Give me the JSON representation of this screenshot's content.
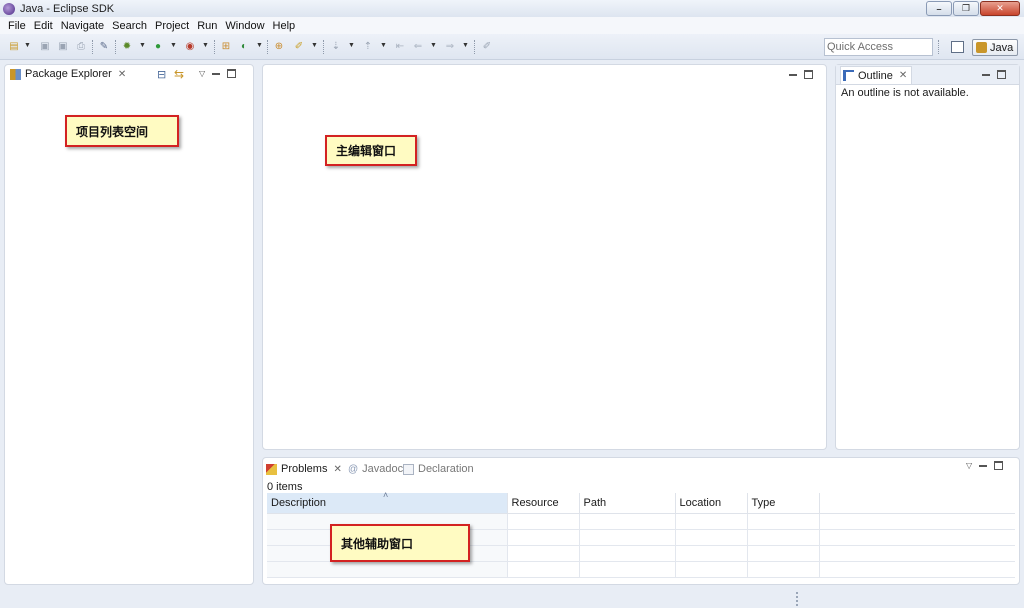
{
  "window": {
    "title": "Java - Eclipse SDK",
    "minimize_glyph": "–",
    "restore_glyph": "❐",
    "close_glyph": "✕"
  },
  "menubar": {
    "items": [
      "File",
      "Edit",
      "Navigate",
      "Search",
      "Project",
      "Run",
      "Window",
      "Help"
    ]
  },
  "toolbar": {
    "quick_access_placeholder": "Quick Access",
    "perspective_label": "Java"
  },
  "package_explorer": {
    "tab_label": "Package Explorer",
    "annotation": "项目列表空间"
  },
  "editor": {
    "annotation": "主编辑窗口"
  },
  "outline": {
    "tab_label": "Outline",
    "message": "An outline is not available."
  },
  "bottom_panel": {
    "tabs": [
      {
        "label": "Problems",
        "active": true
      },
      {
        "label": "Javadoc",
        "active": false
      },
      {
        "label": "Declaration",
        "active": false
      }
    ],
    "items_count": "0 items",
    "columns": [
      "Description",
      "Resource",
      "Path",
      "Location",
      "Type"
    ],
    "annotation": "其他辅助窗口"
  },
  "colors": {
    "annotation_border": "#d32222",
    "annotation_fill": "#fffbc2",
    "sorted_header": "#dce9f7"
  }
}
